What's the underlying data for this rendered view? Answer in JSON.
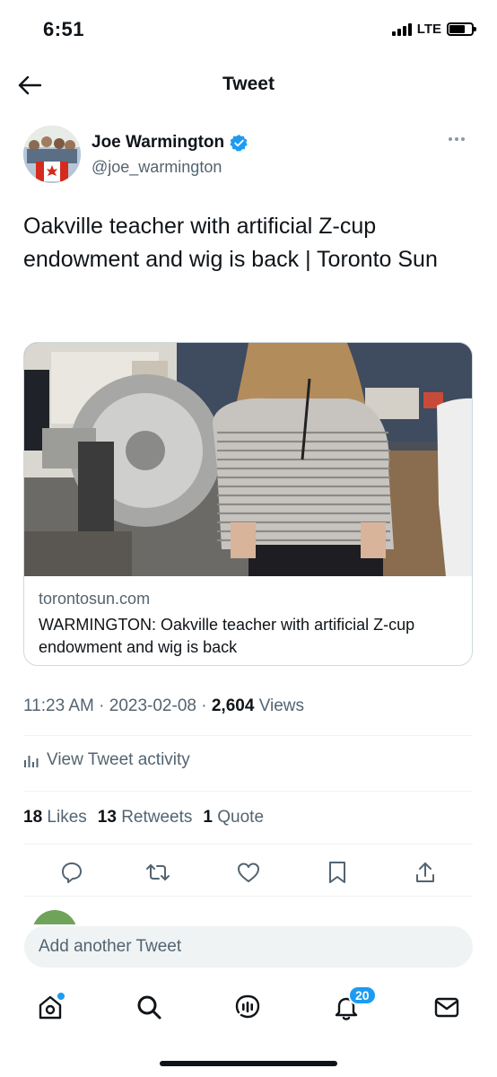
{
  "status_bar": {
    "time": "6:51",
    "network": "LTE"
  },
  "nav": {
    "title": "Tweet",
    "back_icon": "arrow-left-icon"
  },
  "author": {
    "name": "Joe Warmington",
    "handle": "@joe_warmington",
    "verified": true,
    "verified_color": "#1d9bf0"
  },
  "tweet": {
    "text": "Oakville teacher with artificial Z-cup endowment and wig is back | Toronto Sun"
  },
  "card": {
    "domain": "torontosun.com",
    "title": "WARMINGTON: Oakville teacher with artificial Z-cup endowment and wig is back"
  },
  "meta": {
    "time": "11:23 AM",
    "date": "2023-02-08",
    "views_count": "2,604",
    "views_label": "Views",
    "separator": "·"
  },
  "activity": {
    "label": "View Tweet activity",
    "icon": "bar-chart-icon"
  },
  "stats": {
    "likes_count": "18",
    "likes_label": "Likes",
    "retweets_count": "13",
    "retweets_label": "Retweets",
    "quotes_count": "1",
    "quotes_label": "Quote"
  },
  "actions": [
    "reply-icon",
    "retweet-icon",
    "like-icon",
    "bookmark-icon",
    "share-icon"
  ],
  "compose": {
    "placeholder": "Add another Tweet"
  },
  "tabbar": {
    "items": [
      "home-icon",
      "search-icon",
      "spaces-icon",
      "notifications-icon",
      "messages-icon"
    ],
    "notifications_badge": "20"
  },
  "colors": {
    "accent": "#1d9bf0",
    "text": "#0f1419",
    "secondary": "#536471"
  }
}
